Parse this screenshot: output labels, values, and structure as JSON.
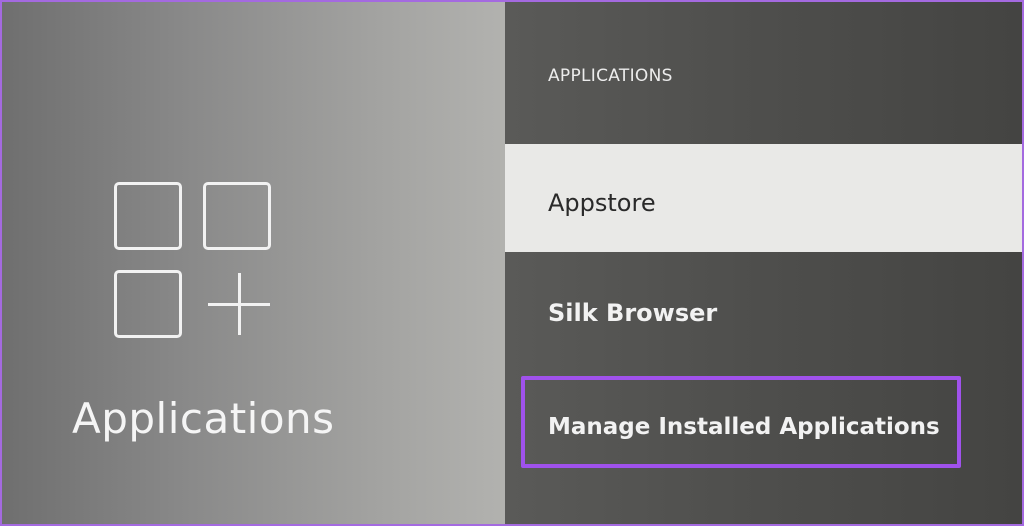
{
  "left_panel": {
    "icon": "applications-grid-plus-icon",
    "title": "Applications"
  },
  "menu": {
    "header": "APPLICATIONS",
    "items": [
      {
        "label": "Appstore",
        "selected": true
      },
      {
        "label": "Silk Browser",
        "selected": false
      },
      {
        "label": "Manage Installed Applications",
        "selected": false,
        "highlighted": true
      }
    ]
  },
  "colors": {
    "highlight_outline": "#a052ec",
    "selected_background": "#e9e9e7",
    "frame_border": "#a46ae0"
  }
}
